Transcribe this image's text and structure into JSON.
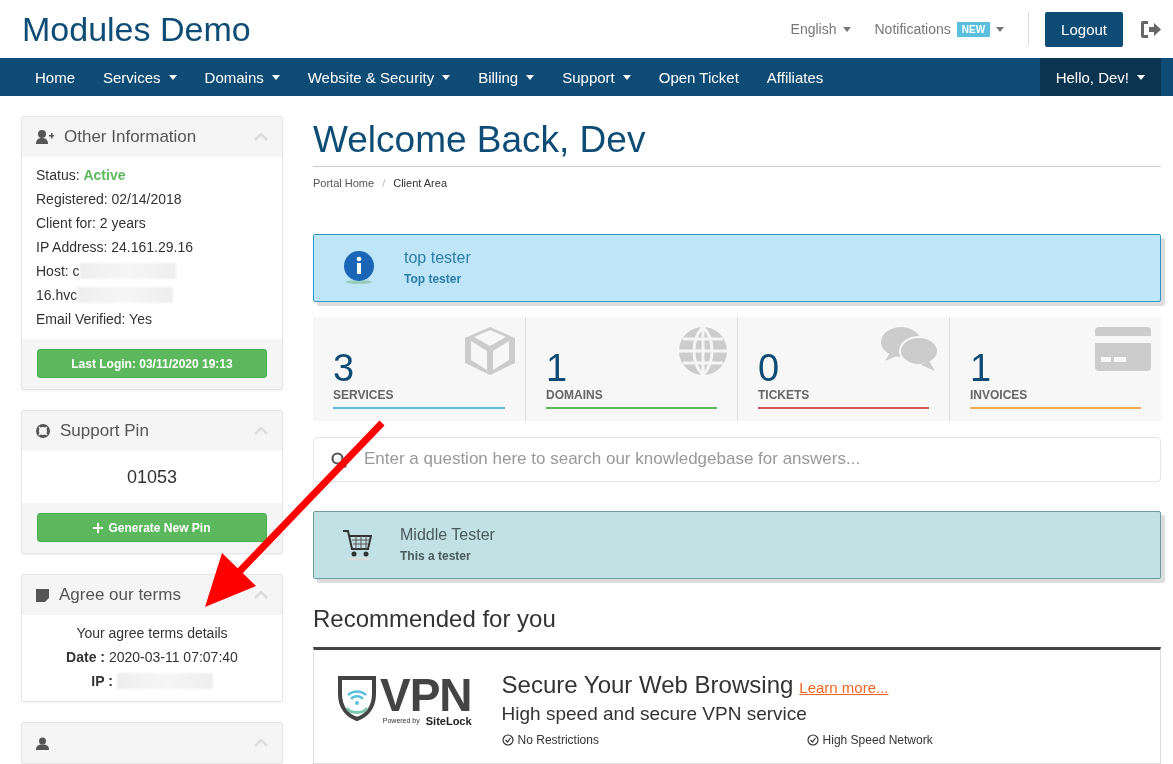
{
  "header": {
    "brand": "Modules Demo",
    "language": "English",
    "notifications": "Notifications",
    "notifications_badge": "NEW",
    "logout": "Logout"
  },
  "nav": {
    "items": [
      {
        "label": "Home",
        "dropdown": false
      },
      {
        "label": "Services",
        "dropdown": true
      },
      {
        "label": "Domains",
        "dropdown": true
      },
      {
        "label": "Website & Security",
        "dropdown": true
      },
      {
        "label": "Billing",
        "dropdown": true
      },
      {
        "label": "Support",
        "dropdown": true
      },
      {
        "label": "Open Ticket",
        "dropdown": false
      },
      {
        "label": "Affiliates",
        "dropdown": false
      }
    ],
    "user": {
      "label": "Hello, Dev!",
      "dropdown": true
    }
  },
  "sidebar": {
    "panels": [
      {
        "kind": "info",
        "title": "Other Information",
        "expanded": true,
        "lines": [
          {
            "label": "Status:",
            "value": "Active",
            "kind": "status",
            "redacted": false
          },
          {
            "label": "Registered:",
            "value": "02/14/2018",
            "kind": "plain",
            "redacted": false
          },
          {
            "label": "Client for:",
            "value": "2 years",
            "kind": "plain",
            "redacted": false
          },
          {
            "label": "IP Address:",
            "value": "24.161.29.16",
            "kind": "plain",
            "redacted": false
          },
          {
            "label": "Host:",
            "value": "c",
            "kind": "plain",
            "redacted": true
          },
          {
            "label": "16.hvc",
            "kind": "plain",
            "redacted": true
          },
          {
            "label": "Email Verified:",
            "value": "Yes",
            "kind": "plain",
            "redacted": false
          }
        ],
        "button": {
          "label": "Last Login: 03/11/2020 19:13",
          "plus": false
        }
      },
      {
        "kind": "pin",
        "title": "Support Pin",
        "expanded": true,
        "lines": [
          {
            "label": "01053",
            "kind": "pin",
            "redacted": false
          }
        ],
        "button": {
          "label": "Generate New Pin",
          "plus": true
        }
      },
      {
        "kind": "terms",
        "title": "Agree our terms",
        "expanded": true,
        "lines": [
          {
            "label": "Your agree terms details",
            "kind": "plain",
            "redacted": false
          },
          {
            "label": "Date :",
            "value": "2020-03-11 07:07:40",
            "kind": "bold-label",
            "redacted": false
          },
          {
            "label": "IP :",
            "kind": "bold-label",
            "redacted": true
          }
        ]
      },
      {
        "kind": "user",
        "expanded": true
      }
    ]
  },
  "main": {
    "title": "Welcome Back, Dev",
    "breadcrumb": [
      {
        "label": "Portal Home",
        "selected": false
      },
      {
        "label": "Client Area",
        "selected": true
      }
    ],
    "breadcrumb_separator": "/",
    "top_alert": {
      "kind": "info",
      "title": "top tester",
      "text": "Top tester"
    },
    "tiles": [
      {
        "count": "3",
        "label": "SERVICES",
        "color": "#5bc0de"
      },
      {
        "count": "1",
        "label": "DOMAINS",
        "color": "#5cb85c"
      },
      {
        "count": "0",
        "label": "TICKETS",
        "color": "#d9534f"
      },
      {
        "count": "1",
        "label": "INVOICES",
        "color": "#f0ad4e"
      }
    ],
    "search": {
      "placeholder": "Enter a question here to search our knowledgebase for answers..."
    },
    "middle_alert": {
      "kind": "cart",
      "title": "Middle Tester",
      "text": "This a tester"
    },
    "recommended": {
      "heading": "Recommended for you",
      "card": {
        "logo": {
          "name": "VPN",
          "powered_by": "Powered by",
          "brand": "SiteLock"
        },
        "title": "Secure Your Web Browsing",
        "link": "Learn more...",
        "subtitle": "High speed and secure VPN service",
        "features": [
          "No Restrictions",
          "High Speed Network"
        ]
      }
    }
  }
}
